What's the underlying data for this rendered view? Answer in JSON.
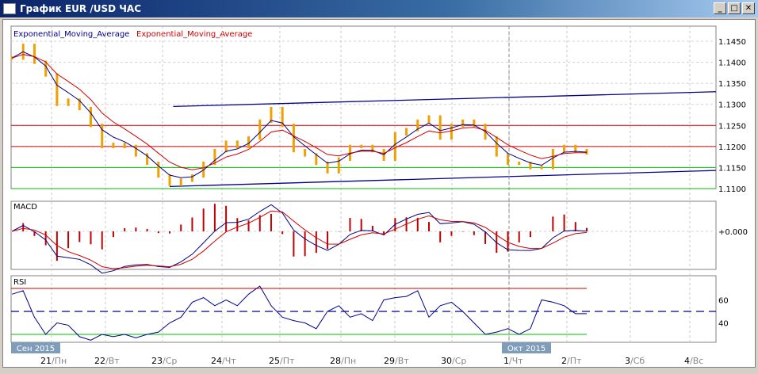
{
  "window": {
    "title": "График EUR /USD  ЧАС",
    "minimize": "_",
    "maximize": "□",
    "close": "✕"
  },
  "legend": {
    "ema1": "Exponential_Moving_Average",
    "ema2": "Exponential_Moving_Average"
  },
  "panes": {
    "macd_label": "MACD",
    "rsi_label": "RSI",
    "macd_zero": "+0.000"
  },
  "colors": {
    "bars": "#f0a000",
    "ema_fast": "#00008b",
    "ema_slow": "#d00000",
    "support": "#00c000",
    "resistance": "#d00000",
    "trend": "#00008b"
  },
  "chart_data": {
    "type": "line",
    "price_ticks": [
      "1.1450",
      "1.1400",
      "1.1350",
      "1.1300",
      "1.1250",
      "1.1200",
      "1.1150",
      "1.1100"
    ],
    "price_range": [
      1.11,
      1.145
    ],
    "levels": {
      "red": [
        1.125,
        1.12
      ],
      "green": [
        1.115,
        1.11
      ]
    },
    "trendlines": [
      [
        0.23,
        1.1295,
        1,
        1.133
      ],
      [
        0.225,
        1.1105,
        1,
        1.1143
      ]
    ],
    "close": [
      1.141,
      1.144,
      1.14,
      1.137,
      1.13,
      1.131,
      1.129,
      1.125,
      1.12,
      1.1205,
      1.12,
      1.118,
      1.116,
      1.113,
      1.111,
      1.112,
      1.113,
      1.116,
      1.119,
      1.121,
      1.12,
      1.122,
      1.126,
      1.129,
      1.125,
      1.119,
      1.118,
      1.116,
      1.114,
      1.117,
      1.12,
      1.12,
      1.119,
      1.117,
      1.123,
      1.124,
      1.126,
      1.127,
      1.122,
      1.125,
      1.126,
      1.125,
      1.122,
      1.118,
      1.116,
      1.116,
      1.115,
      1.115,
      1.119,
      1.12,
      1.119,
      1.1185
    ],
    "rsi": [
      65,
      68,
      45,
      30,
      40,
      38,
      28,
      25,
      30,
      28,
      30,
      27,
      30,
      32,
      40,
      45,
      58,
      62,
      55,
      60,
      55,
      65,
      72,
      55,
      45,
      42,
      40,
      35,
      50,
      55,
      45,
      48,
      42,
      60,
      62,
      63,
      68,
      45,
      55,
      58,
      50,
      40,
      30,
      32,
      35,
      30,
      35,
      60,
      58,
      55,
      48,
      48
    ],
    "rsi_ticks": [
      "60",
      "40"
    ],
    "rsi_levels": [
      70,
      50,
      30
    ],
    "x_labels": [
      {
        "d": "21",
        "w": "/Пн"
      },
      {
        "d": "22",
        "w": "/Вт"
      },
      {
        "d": "23",
        "w": "/Ср"
      },
      {
        "d": "24",
        "w": "/Чт"
      },
      {
        "d": "25",
        "w": "/Пт"
      },
      {
        "d": "28",
        "w": "/Пн"
      },
      {
        "d": "29",
        "w": "/Вт"
      },
      {
        "d": "30",
        "w": "/Ср"
      },
      {
        "d": "1",
        "w": "/Чт"
      },
      {
        "d": "2",
        "w": "/Пт"
      },
      {
        "d": "3",
        "w": "/Сб"
      },
      {
        "d": "4",
        "w": "/Вс"
      }
    ],
    "month_labels": [
      "Сен 2015",
      "Окт 2015"
    ]
  }
}
